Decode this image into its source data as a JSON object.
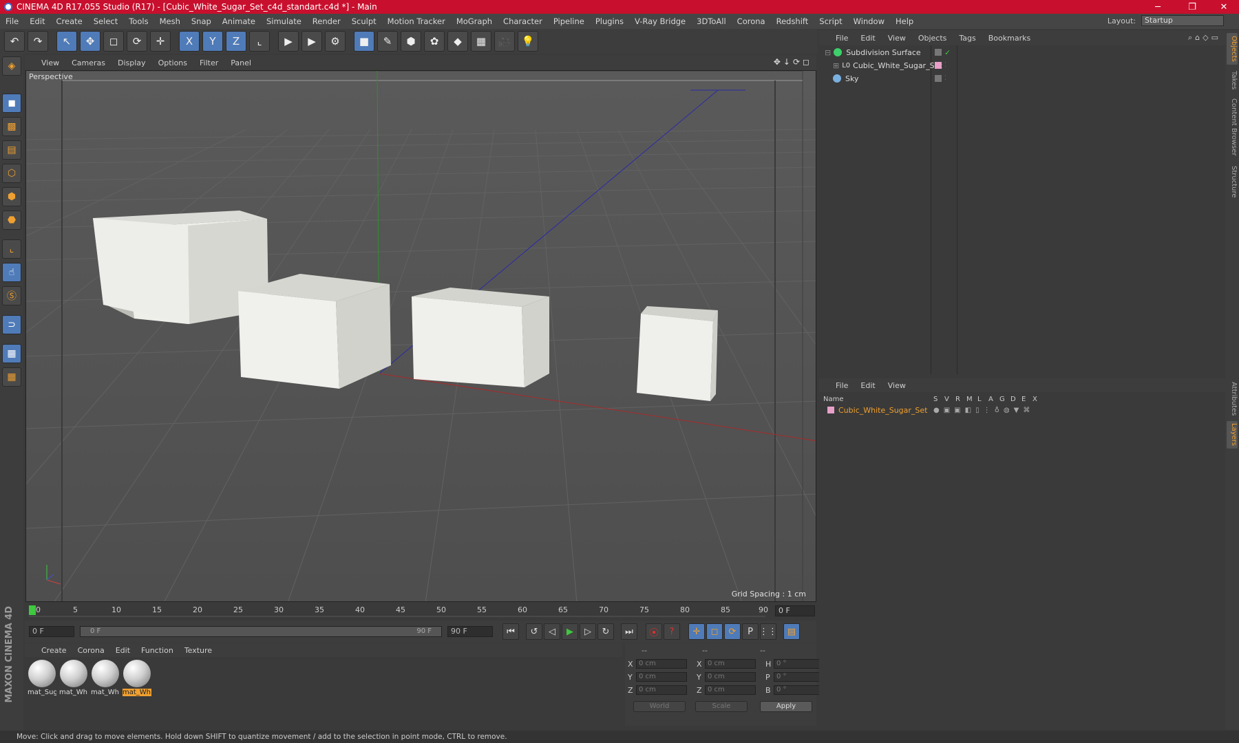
{
  "window": {
    "title": "CINEMA 4D R17.055 Studio (R17) - [Cubic_White_Sugar_Set_c4d_standart.c4d *] - Main",
    "minimize": "─",
    "maximize": "❐",
    "close": "✕"
  },
  "menubar": {
    "items": [
      "File",
      "Edit",
      "Create",
      "Select",
      "Tools",
      "Mesh",
      "Snap",
      "Animate",
      "Simulate",
      "Render",
      "Sculpt",
      "Motion Tracker",
      "MoGraph",
      "Character",
      "Pipeline",
      "Plugins",
      "V-Ray Bridge",
      "3DToAll",
      "Corona",
      "Redshift",
      "Script",
      "Window",
      "Help"
    ],
    "layout_label": "Layout:",
    "layout_value": "Startup"
  },
  "toolbar": {
    "undo": "↶",
    "redo": "↷",
    "select": "↖",
    "move": "✥",
    "scale": "◻",
    "rotate": "⟳",
    "transform": "✛",
    "x": "X",
    "y": "Y",
    "z": "Z",
    "coord": "⌞",
    "render_view": "▶",
    "render_picture": "▶",
    "render_settings": "⚙",
    "cube": "■",
    "pen": "✎",
    "subdiv": "⬢",
    "array": "✿",
    "deformer": "◆",
    "floor": "▦",
    "camera": "🎥",
    "light": "💡"
  },
  "viewport": {
    "menu": [
      "View",
      "Cameras",
      "Display",
      "Options",
      "Filter",
      "Panel"
    ],
    "label": "Perspective",
    "grid_spacing": "Grid Spacing : 1 cm",
    "nav_icons": "✥↓⟳◻"
  },
  "timeline": {
    "ticks": [
      "0",
      "5",
      "10",
      "15",
      "20",
      "25",
      "30",
      "35",
      "40",
      "45",
      "50",
      "55",
      "60",
      "65",
      "70",
      "75",
      "80",
      "85",
      "90"
    ],
    "frame_field": "0 F",
    "start_field": "0 F",
    "range_start": "0 F",
    "range_end": "90 F",
    "end_field": "90 F"
  },
  "playback": {
    "first": "⏮",
    "prev_key": "↺",
    "prev": "◁",
    "play": "▶",
    "next": "▷",
    "next_key": "↻",
    "last": "⏭",
    "record": "⦿",
    "auto": "?",
    "motion": "✛",
    "scale": "◻",
    "rot": "⟳",
    "param": "P",
    "pla": "⋮⋮",
    "timeline_btn": "▤"
  },
  "materials": {
    "menu": [
      "Create",
      "Corona",
      "Edit",
      "Function",
      "Texture"
    ],
    "items": [
      {
        "label": "mat_Sug"
      },
      {
        "label": "mat_Wh"
      },
      {
        "label": "mat_Wh"
      },
      {
        "label": "mat_Wh"
      }
    ]
  },
  "coords": {
    "header": [
      "--",
      "--",
      "--"
    ],
    "rows": [
      {
        "a1": "X",
        "v1": "0 cm",
        "a2": "X",
        "v2": "0 cm",
        "a3": "H",
        "v3": "0 °"
      },
      {
        "a1": "Y",
        "v1": "0 cm",
        "a2": "Y",
        "v2": "0 cm",
        "a3": "P",
        "v3": "0 °"
      },
      {
        "a1": "Z",
        "v1": "0 cm",
        "a2": "Z",
        "v2": "0 cm",
        "a3": "B",
        "v3": "0 °"
      }
    ],
    "world": "World",
    "scale": "Scale",
    "apply": "Apply"
  },
  "objects": {
    "menu": [
      "File",
      "Edit",
      "View",
      "Objects",
      "Tags",
      "Bookmarks"
    ],
    "icons": "⌕⌂◇▭",
    "items": [
      {
        "name": "Subdivision Surface",
        "color": "#3ecf6a"
      },
      {
        "name": "Cubic_White_Sugar_Set",
        "color": "#cfcfcf"
      },
      {
        "name": "Sky",
        "color": "#7ab0e0"
      }
    ]
  },
  "layers": {
    "menu": [
      "File",
      "Edit",
      "View"
    ],
    "columns": [
      "Name",
      "S",
      "V",
      "R",
      "M",
      "L",
      "A",
      "G",
      "D",
      "E",
      "X"
    ],
    "items": [
      {
        "name": "Cubic_White_Sugar_Set",
        "color": "#e8a0c8"
      }
    ]
  },
  "sidetabs": [
    "Objects",
    "Takes",
    "Content Browser",
    "Structure",
    "Attributes",
    "Layers"
  ],
  "status": "Move: Click and drag to move elements. Hold down SHIFT to quantize movement / add to the selection in point mode, CTRL to remove.",
  "brand": "MAXON CINEMA 4D",
  "colors": {
    "title_bar": "#c8102e",
    "accent": "#f0a030",
    "active_blue": "#4f7bb8"
  }
}
